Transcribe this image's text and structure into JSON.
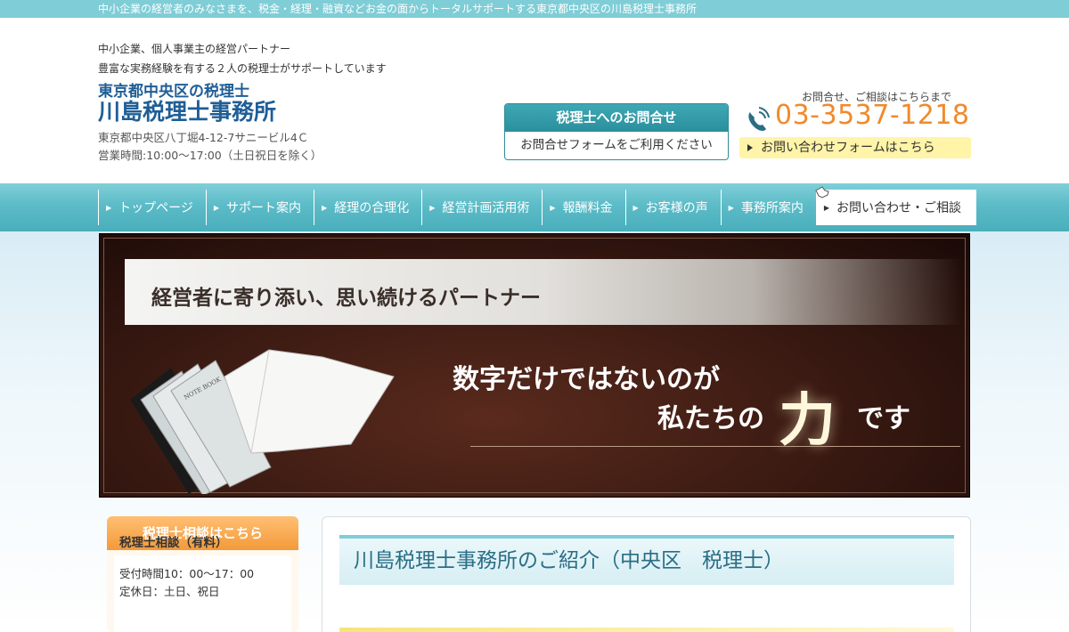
{
  "topbar": {
    "text": "中小企業の経営者のみなさまを、税金・経理・融資などお金の面からトータルサポートする東京都中央区の川島税理士事務所"
  },
  "header": {
    "tagline1": "中小企業、個人事業主の経営パートナー",
    "tagline2": "豊富な実務経験を有する２人の税理士がサポートしています",
    "sub_title": "東京都中央区の税理士",
    "title": "川島税理士事務所",
    "address": "東京都中央区八丁堀4-12-7サニービル4Ｃ",
    "hours": "営業時間:10:00～17:00（土日祝日を除く）"
  },
  "contact_box": {
    "head": "税理士へのお問合せ",
    "body": "お問合せフォームをご利用ください"
  },
  "phone_area": {
    "label": "お問合せ、ご相談はこちらまで",
    "phone": "03-3537-1218",
    "form_link": "お問い合わせフォームはこちら"
  },
  "nav": {
    "items": [
      {
        "label": "トップページ"
      },
      {
        "label": "サポート案内"
      },
      {
        "label": "経理の合理化"
      },
      {
        "label": "経営計画活用術"
      },
      {
        "label": "報酬料金"
      },
      {
        "label": "お客様の声"
      },
      {
        "label": "事務所案内"
      },
      {
        "label": "お問い合わせ・ご相談"
      }
    ]
  },
  "hero": {
    "slogan": "経営者に寄り添い、思い続けるパートナー",
    "line1": "数字だけではないのが",
    "line2": "私たちの",
    "big": "力",
    "line3": "です",
    "notebook_label": "NOTE BOOK"
  },
  "sidebar": {
    "head": "税理士相談はこちら",
    "title": "税理士相談（有料）",
    "line1": "受付時間10：00～17：00",
    "line2": "定休日：土日、祝日"
  },
  "content": {
    "title": "川島税理士事務所のご紹介（中央区　税理士）"
  },
  "colors": {
    "accent": "#7fcdd6",
    "brand_blue": "#1f5e96",
    "phone_orange": "#f08a2c",
    "sidebar_orange": "#f39a3a"
  }
}
